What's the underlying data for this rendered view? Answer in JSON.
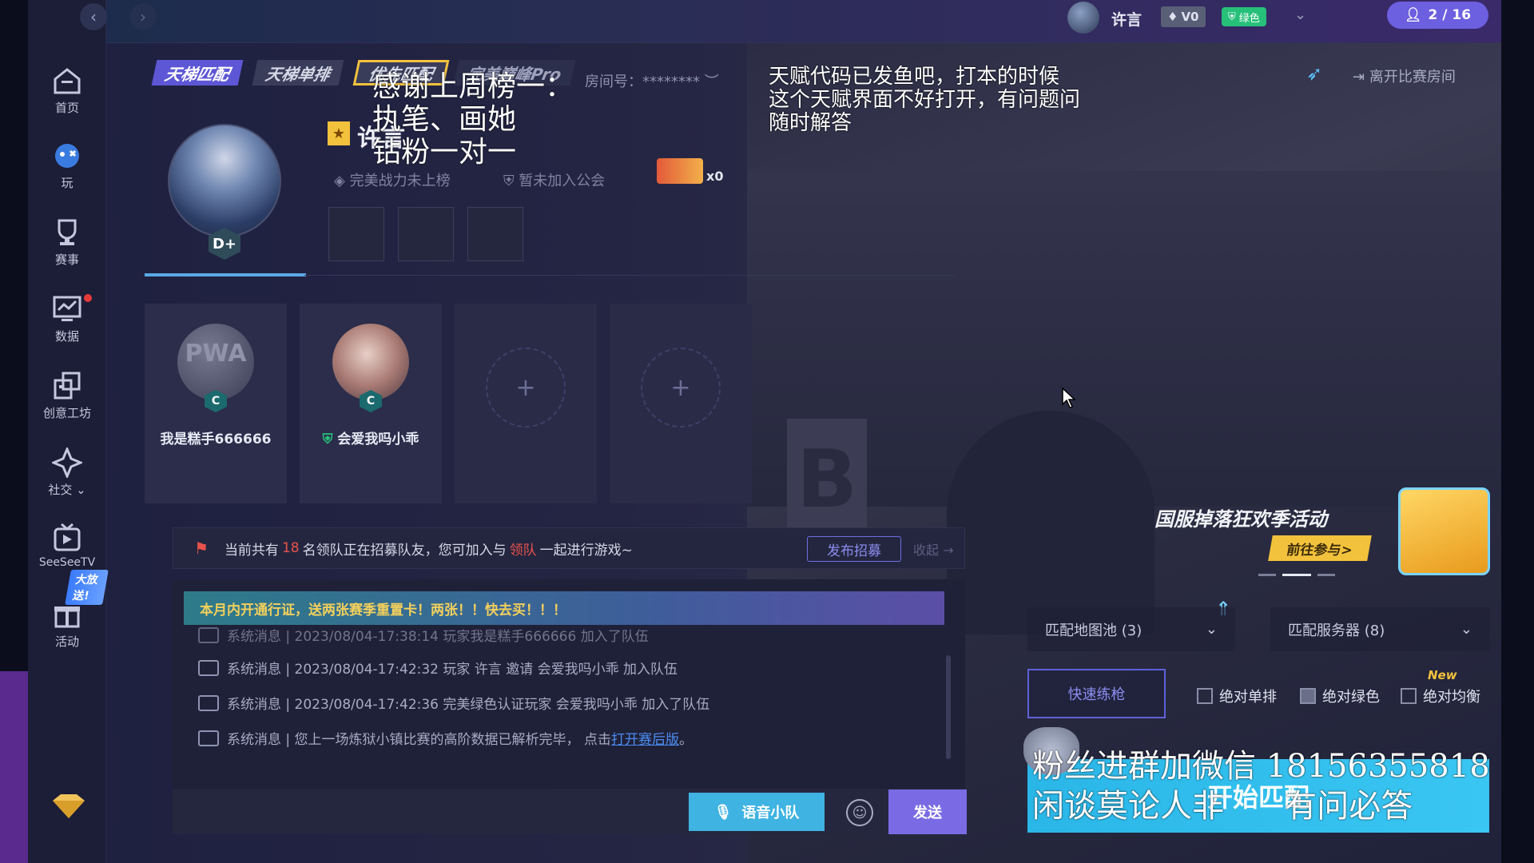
{
  "colors": {
    "accent": "#7a6be4",
    "cyan": "#3fb3e2",
    "gold": "#f3c23c",
    "highlight": "#e9524c",
    "green": "#27c07a"
  },
  "topbar": {
    "user_name": "许言",
    "vip_level": "V0",
    "green_badge": "绿色",
    "room_count": "2 / 16"
  },
  "sidebar": {
    "items": [
      {
        "label": "首页",
        "icon": "home-icon"
      },
      {
        "label": "玩",
        "icon": "gamepad-icon"
      },
      {
        "label": "赛事",
        "icon": "trophy-icon"
      },
      {
        "label": "数据",
        "icon": "chart-icon"
      },
      {
        "label": "创意工坊",
        "icon": "workshop-icon"
      },
      {
        "label": "社交",
        "icon": "social-icon"
      },
      {
        "label": "SeeSeeTV",
        "icon": "tv-icon"
      },
      {
        "label": "活动",
        "icon": "gift-icon"
      }
    ],
    "gift_badge": "大放送!"
  },
  "mode_tabs": [
    "天梯匹配",
    "天梯单排",
    "优先匹配",
    "完美巅峰Pro"
  ],
  "room": {
    "room_id_label": "房间号：********",
    "leave_label": "离开比赛房间"
  },
  "profile": {
    "name": "许言",
    "power_rank": "完美战力未上榜",
    "guild": "暂未加入公会",
    "ticket_count": "x0",
    "level_badge": "D+"
  },
  "team": [
    {
      "name": "我是糕手666666",
      "rank": "C",
      "avatar_text": "PWA"
    },
    {
      "name": "会爱我吗小乖",
      "rank": "C",
      "avatar_text": ""
    }
  ],
  "notice": {
    "prefix": "当前共有",
    "count": "18",
    "middle": "名领队正在招募队友，您可加入与",
    "highlight": "领队",
    "suffix": "一起进行游戏~",
    "publish_button": "发布招募",
    "collapse_label": "收起"
  },
  "chat": {
    "banner": "本月内开通行证，送两张赛季重置卡！两张！！快去买！！！",
    "messages": [
      "系统消息 | 2023/08/04-17:38:14 玩家我是糕手666666 加入了队伍",
      "系统消息 | 2023/08/04-17:42:32 玩家 许言 邀请 会爱我吗小乖 加入队伍",
      "系统消息 | 2023/08/04-17:42:36 完美绿色认证玩家 会爱我吗小乖 加入了队伍"
    ],
    "last_prefix": "系统消息 | 您上一场炼狱小镇比赛的高阶数据已解析完毕， 点击",
    "last_link": "打开赛后版",
    "last_suffix": "。",
    "voice_button": "语音小队",
    "send_button": "发送"
  },
  "event": {
    "title": "国服掉落狂欢季活动",
    "cta": "前往参与>"
  },
  "match": {
    "map_pool": "匹配地图池 (3)",
    "server_pool": "匹配服务器 (8)",
    "quick_practice": "快速练枪",
    "options": [
      "绝对单排",
      "绝对绿色",
      "绝对均衡"
    ],
    "new_label": "New",
    "start_button": "开始匹配"
  },
  "overlay": {
    "thanks": [
      "感谢上周榜一：",
      "执笔、画她",
      "钻粉一对一"
    ],
    "talent": [
      "天赋代码已发鱼吧，打本的时候",
      "这个天赋界面不好打开，有问题问",
      "随时解答"
    ],
    "wechat_line1": "粉丝进群加微信 18156355818",
    "wechat_line2": "闲谈莫论人非      有问必答"
  }
}
